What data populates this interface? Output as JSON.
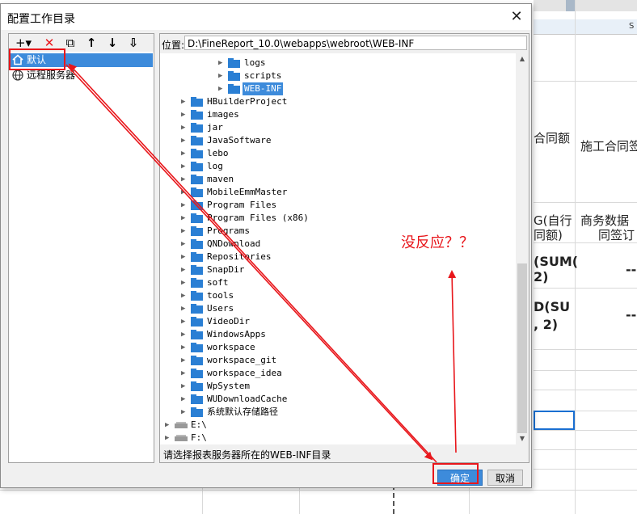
{
  "dialog": {
    "title": "配置工作目录",
    "close_glyph": "✕"
  },
  "toolbar": {
    "add_glyph": "+▾",
    "delete_glyph": "✕",
    "copy_glyph": "⧉",
    "up_glyph": "↑",
    "down_glyph": "↓",
    "sort_glyph": "⇩"
  },
  "left_tree": {
    "items": [
      {
        "label": "默认",
        "icon": "home-icon",
        "selected": true
      },
      {
        "label": "远程服务器",
        "icon": "globe-icon",
        "selected": false
      }
    ]
  },
  "path": {
    "label": "位置:",
    "value": "D:\\FineReport_10.0\\webapps\\webroot\\WEB-INF"
  },
  "file_tree": {
    "nested": [
      {
        "label": "logs"
      },
      {
        "label": "scripts"
      },
      {
        "label": "WEB-INF",
        "highlighted": true
      }
    ],
    "folders": [
      {
        "label": "HBuilderProject"
      },
      {
        "label": "images"
      },
      {
        "label": "jar"
      },
      {
        "label": "JavaSoftware"
      },
      {
        "label": "lebo"
      },
      {
        "label": "log"
      },
      {
        "label": "maven"
      },
      {
        "label": "MobileEmmMaster"
      },
      {
        "label": "Program Files"
      },
      {
        "label": "Program Files (x86)"
      },
      {
        "label": "Programs"
      },
      {
        "label": "QNDownload"
      },
      {
        "label": "Repositories"
      },
      {
        "label": "SnapDir"
      },
      {
        "label": "soft"
      },
      {
        "label": "tools"
      },
      {
        "label": "Users"
      },
      {
        "label": "VideoDir"
      },
      {
        "label": "WindowsApps"
      },
      {
        "label": "workspace"
      },
      {
        "label": "workspace_git"
      },
      {
        "label": "workspace_idea"
      },
      {
        "label": "WpSystem"
      },
      {
        "label": "WUDownloadCache"
      },
      {
        "label": "系统默认存储路径"
      }
    ],
    "drives": [
      {
        "label": "E:\\"
      },
      {
        "label": "F:\\"
      }
    ]
  },
  "hint": "请选择报表服务器所在的WEB-INF目录",
  "buttons": {
    "ok": "确定",
    "cancel": "取消"
  },
  "annotation": {
    "text": "没反应？？",
    "color": "#e8161b"
  },
  "background_sheet": {
    "column_letter": "S",
    "cells": [
      {
        "text": "合同额",
        "id": "c1"
      },
      {
        "text": "施工合同签",
        "id": "c2"
      },
      {
        "text": "G(自行",
        "id": "c3"
      },
      {
        "text": "同额)",
        "id": "c4"
      },
      {
        "text": "商务数据（",
        "id": "c5"
      },
      {
        "text": "同签订",
        "id": "c6"
      },
      {
        "text": "(SUM(",
        "id": "c7"
      },
      {
        "text": "2)",
        "id": "c8"
      },
      {
        "text": "D(SU",
        "id": "c9"
      },
      {
        "text": ", 2)",
        "id": "c10"
      },
      {
        "text": "--",
        "id": "c11"
      },
      {
        "text": "--",
        "id": "c12"
      }
    ]
  },
  "colors": {
    "selection_blue": "#3d8bdb",
    "folder_blue": "#2a7fd4",
    "annotation_red": "#e8161b"
  }
}
